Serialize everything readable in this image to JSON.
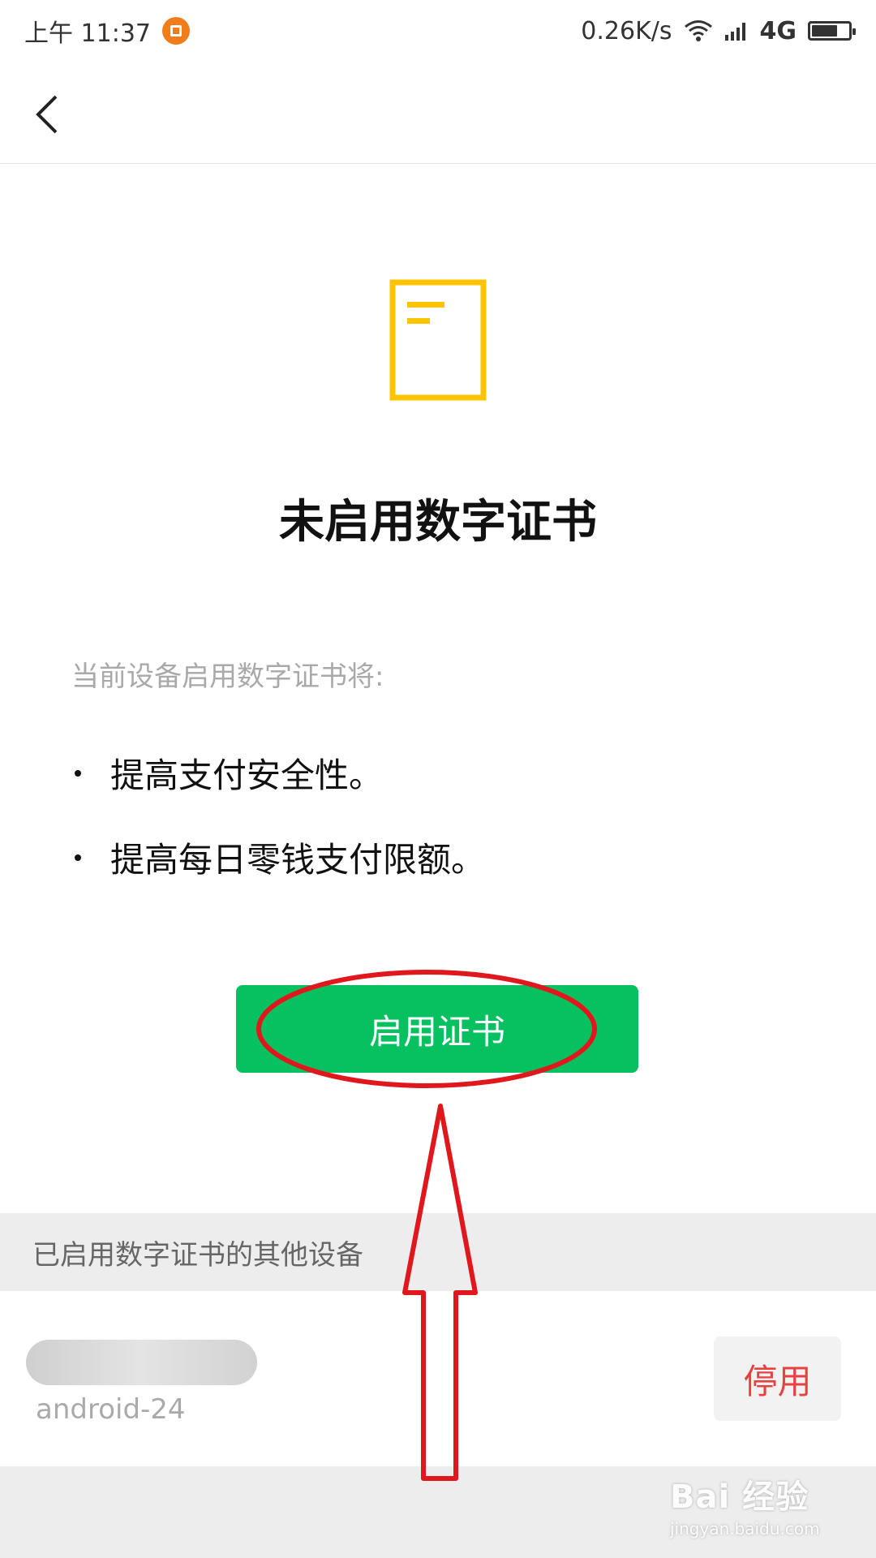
{
  "status_bar": {
    "time": "上午 11:37",
    "network_speed": "0.26K/s",
    "network_type": "4G",
    "battery_level": 0.7
  },
  "nav": {
    "back_icon": "chevron-left-icon"
  },
  "hero": {
    "icon": "certificate-document-icon",
    "icon_color": "#ffc300",
    "title": "未启用数字证书"
  },
  "description": {
    "subtitle": "当前设备启用数字证书将:",
    "benefits": [
      "提高支付安全性。",
      "提高每日零钱支付限额。"
    ]
  },
  "primary_button": {
    "label": "启用证书",
    "color": "#07c160"
  },
  "other_devices": {
    "header": "已启用数字证书的其他设备",
    "devices": [
      {
        "subtitle": "android-24",
        "action_label": "停用",
        "action_color": "#e64340"
      }
    ]
  },
  "watermark": {
    "main": "Bai 经验",
    "sub": "jingyan.baidu.com"
  },
  "annotation_color": "#e0181e"
}
